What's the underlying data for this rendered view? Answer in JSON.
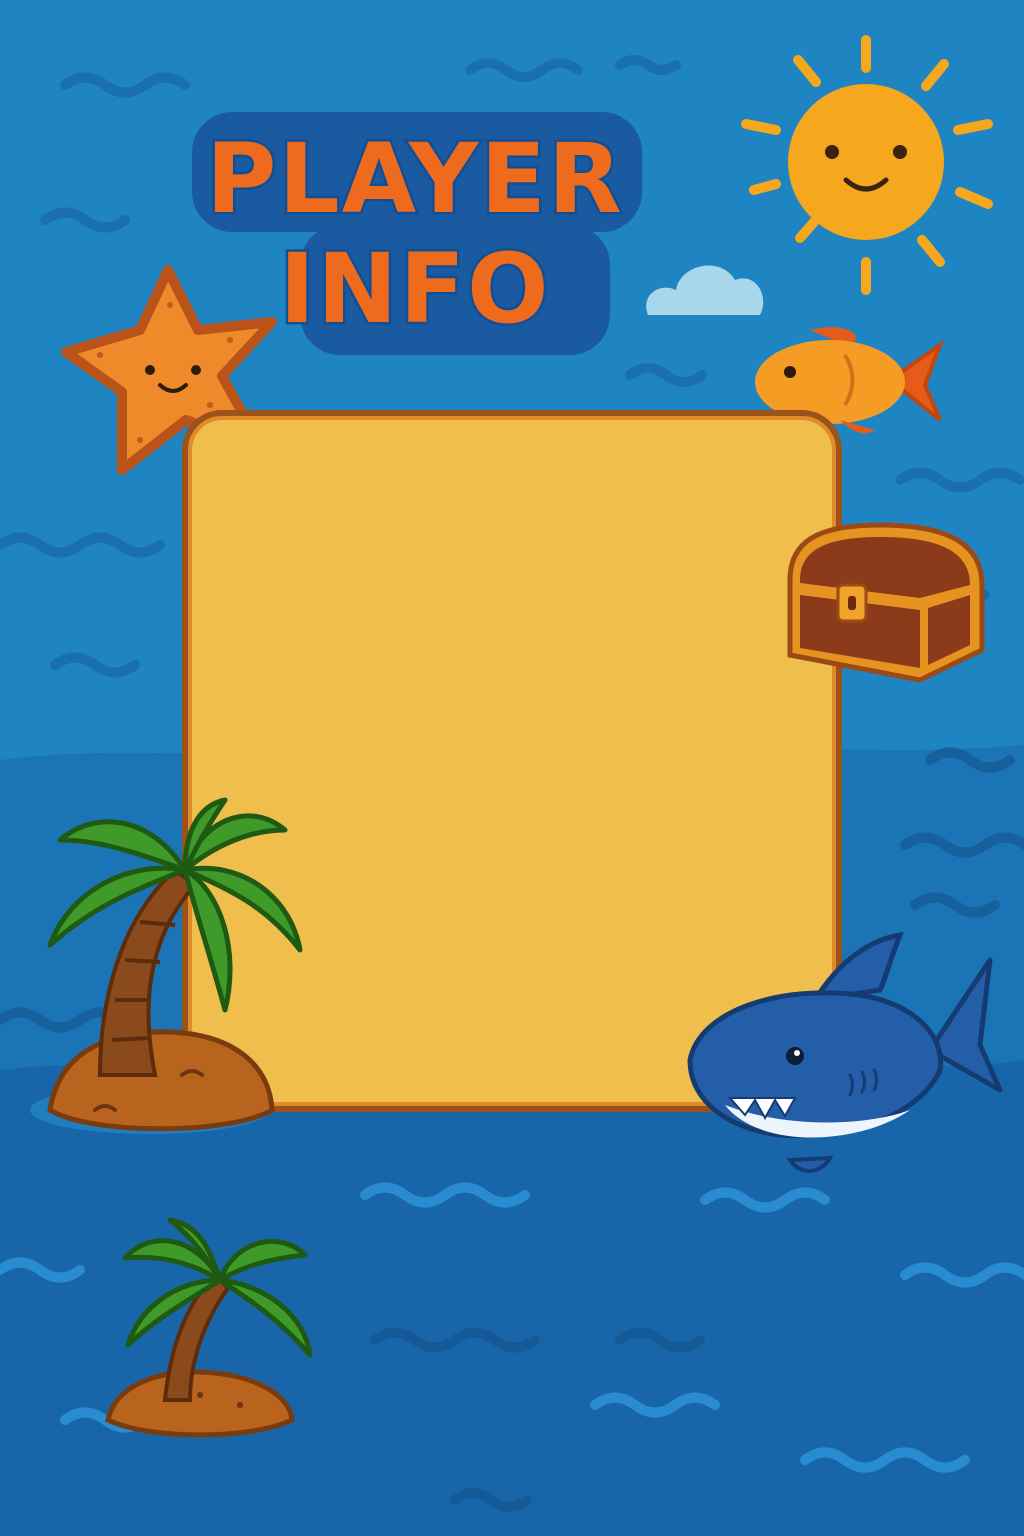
{
  "title": {
    "line1": "PLAYER",
    "line2": "INFO"
  },
  "colors": {
    "sky_top": "#1f85c2",
    "sea_mid": "#1b70b3",
    "sea_deep": "#1865a8",
    "title_fill": "#ee6a1c",
    "title_outline": "#124e95",
    "panel_fill": "#f0be4c",
    "panel_border": "#9a5319",
    "sun": "#f5a81d",
    "palm_leaf": "#3f9a2a",
    "palm_trunk": "#8a4a1c",
    "island": "#b8641e",
    "shark": "#245ea8",
    "fish": "#f08a20",
    "starfish": "#ee8a2a",
    "chest": "#8b3b1a"
  },
  "decorations": {
    "icons": [
      "sun-icon",
      "cloud-icon",
      "starfish-icon",
      "fish-icon",
      "treasure-chest-icon",
      "palm-island-icon",
      "shark-icon",
      "small-palm-island-icon"
    ]
  }
}
